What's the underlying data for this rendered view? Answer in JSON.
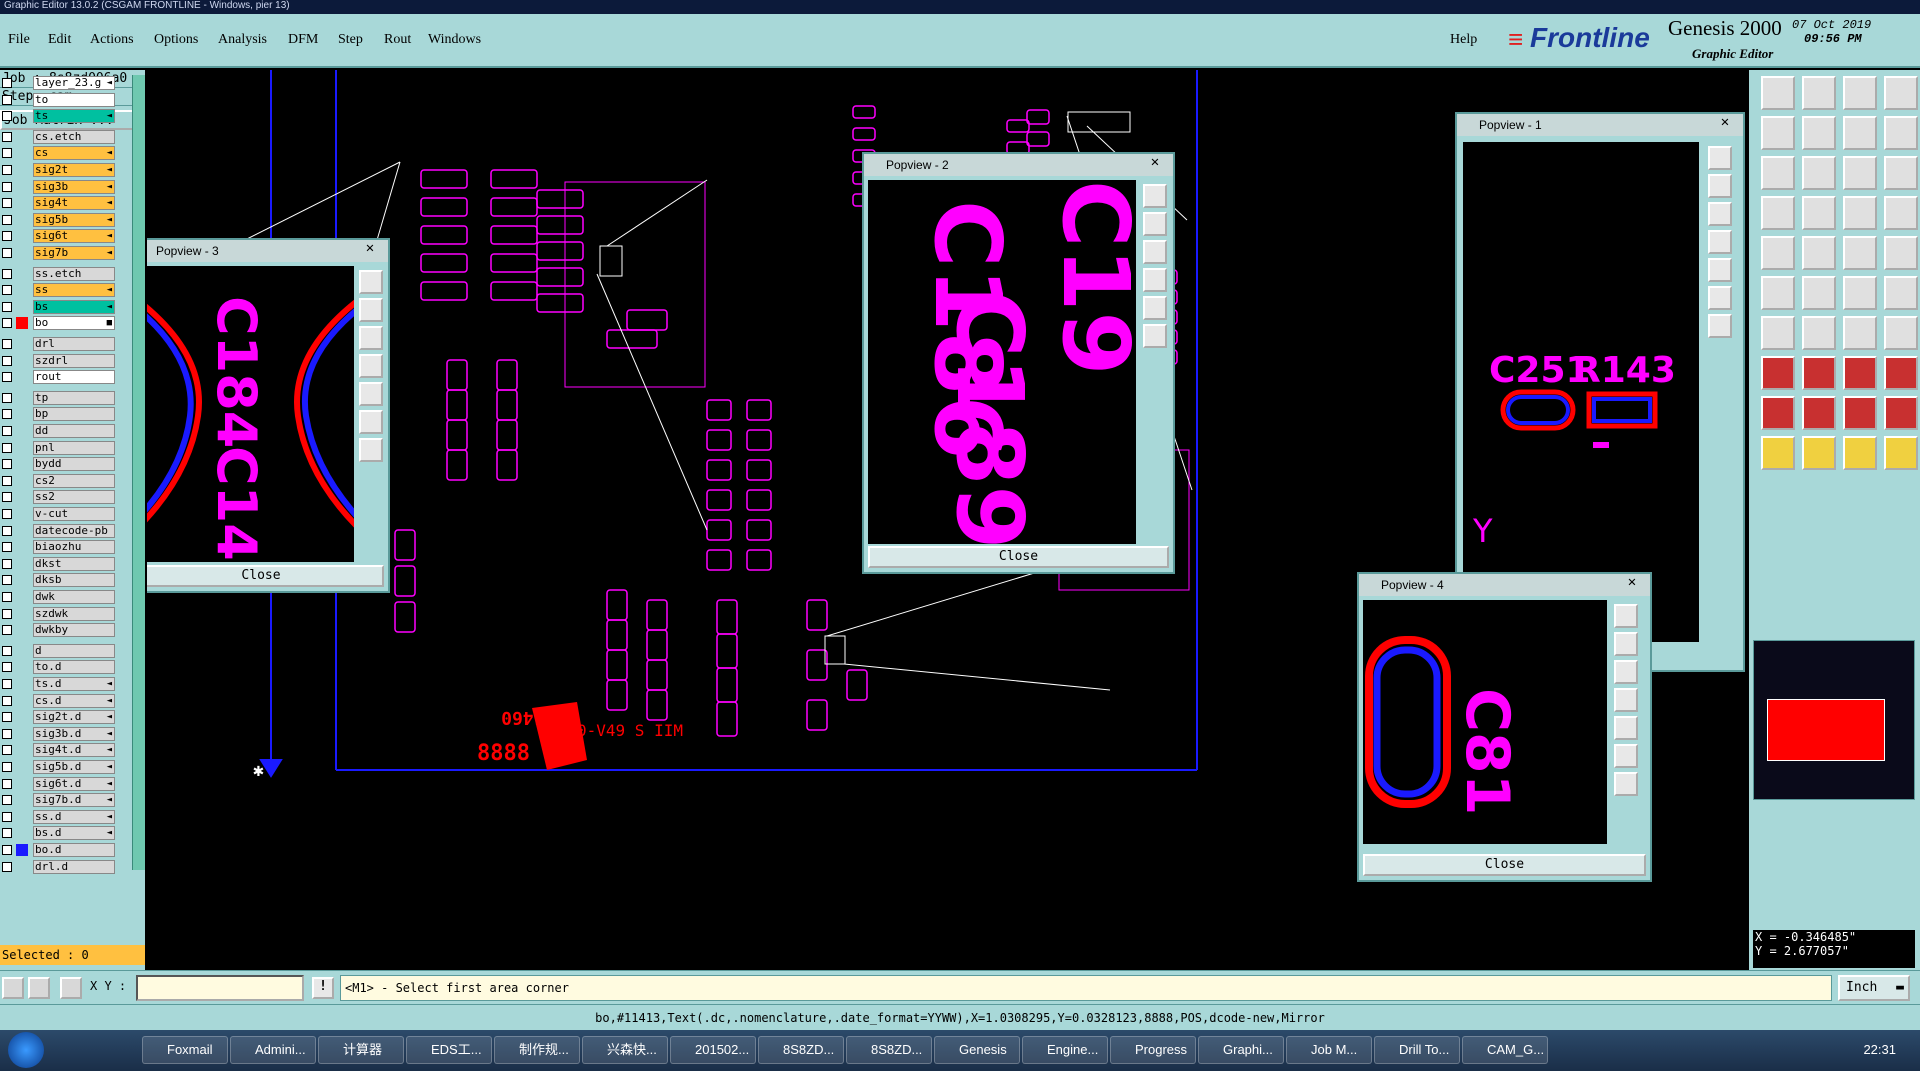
{
  "titlebar": {
    "title": "Graphic Editor 13.0.2 (CSGAM FRONTLINE - Windows, pier 13)"
  },
  "menu": {
    "items": [
      "File",
      "Edit",
      "Actions",
      "Options",
      "Analysis",
      "DFM",
      "Step",
      "Rout",
      "Windows"
    ],
    "help": "Help"
  },
  "brand": {
    "logo": "Frontline",
    "product": "Genesis 2000",
    "subtitle": "Graphic Editor",
    "date": "07 Oct 2019",
    "time": "09:56 PM"
  },
  "job": {
    "job": "Job : 8s8zd006a0",
    "step": "Step: cam",
    "matrix": "Job Matrix ..."
  },
  "layers": [
    {
      "name": "layer_23.g",
      "color": "#ffffff",
      "mark": "◄"
    },
    {
      "name": "to",
      "color": "#ffffff",
      "mark": ""
    },
    {
      "name": "ts",
      "color": "#00c0a0",
      "mark": "◄"
    },
    {
      "name": "cs.etch",
      "color": "#d8d8d8",
      "mark": ""
    },
    {
      "name": "cs",
      "color": "#ffc040",
      "mark": "◄"
    },
    {
      "name": "sig2t",
      "color": "#ffc040",
      "mark": "◄"
    },
    {
      "name": "sig3b",
      "color": "#ffc040",
      "mark": "◄"
    },
    {
      "name": "sig4t",
      "color": "#ffc040",
      "mark": "◄"
    },
    {
      "name": "sig5b",
      "color": "#ffc040",
      "mark": "◄"
    },
    {
      "name": "sig6t",
      "color": "#ffc040",
      "mark": "◄"
    },
    {
      "name": "sig7b",
      "color": "#ffc040",
      "mark": "◄"
    },
    {
      "name": "ss.etch",
      "color": "#d8d8d8",
      "mark": ""
    },
    {
      "name": "ss",
      "color": "#ffc040",
      "mark": "◄"
    },
    {
      "name": "bs",
      "color": "#00c0a0",
      "mark": "◄"
    },
    {
      "name": "bo",
      "color": "#ffffff",
      "mark": "■"
    },
    {
      "name": "drl",
      "color": "#d8d8d8",
      "mark": ""
    },
    {
      "name": "szdrl",
      "color": "#d8d8d8",
      "mark": ""
    },
    {
      "name": "rout",
      "color": "#ffffff",
      "mark": ""
    },
    {
      "name": "tp",
      "color": "#d8d8d8",
      "mark": ""
    },
    {
      "name": "bp",
      "color": "#d8d8d8",
      "mark": ""
    },
    {
      "name": "dd",
      "color": "#d8d8d8",
      "mark": ""
    },
    {
      "name": "pnl",
      "color": "#d8d8d8",
      "mark": ""
    },
    {
      "name": "bydd",
      "color": "#d8d8d8",
      "mark": ""
    },
    {
      "name": "cs2",
      "color": "#d8d8d8",
      "mark": ""
    },
    {
      "name": "ss2",
      "color": "#d8d8d8",
      "mark": ""
    },
    {
      "name": "v-cut",
      "color": "#d8d8d8",
      "mark": ""
    },
    {
      "name": "datecode-pb",
      "color": "#d8d8d8",
      "mark": ""
    },
    {
      "name": "biaozhu",
      "color": "#d8d8d8",
      "mark": ""
    },
    {
      "name": "dkst",
      "color": "#d8d8d8",
      "mark": ""
    },
    {
      "name": "dksb",
      "color": "#d8d8d8",
      "mark": ""
    },
    {
      "name": "dwk",
      "color": "#d8d8d8",
      "mark": ""
    },
    {
      "name": "szdwk",
      "color": "#d8d8d8",
      "mark": ""
    },
    {
      "name": "dwkby",
      "color": "#d8d8d8",
      "mark": ""
    },
    {
      "name": "d",
      "color": "#d8d8d8",
      "mark": ""
    },
    {
      "name": "to.d",
      "color": "#d8d8d8",
      "mark": ""
    },
    {
      "name": "ts.d",
      "color": "#d8d8d8",
      "mark": "◄"
    },
    {
      "name": "cs.d",
      "color": "#d8d8d8",
      "mark": "◄"
    },
    {
      "name": "sig2t.d",
      "color": "#d8d8d8",
      "mark": "◄"
    },
    {
      "name": "sig3b.d",
      "color": "#d8d8d8",
      "mark": "◄"
    },
    {
      "name": "sig4t.d",
      "color": "#d8d8d8",
      "mark": "◄"
    },
    {
      "name": "sig5b.d",
      "color": "#d8d8d8",
      "mark": "◄"
    },
    {
      "name": "sig6t.d",
      "color": "#d8d8d8",
      "mark": "◄"
    },
    {
      "name": "sig7b.d",
      "color": "#d8d8d8",
      "mark": "◄"
    },
    {
      "name": "ss.d",
      "color": "#d8d8d8",
      "mark": "◄"
    },
    {
      "name": "bs.d",
      "color": "#d8d8d8",
      "mark": "◄"
    },
    {
      "name": "bo.d",
      "color": "#d8d8d8",
      "mark": ""
    },
    {
      "name": "drl.d",
      "color": "#d8d8d8",
      "mark": ""
    }
  ],
  "selected": "Selected : 0",
  "cmd": {
    "xy_label": "X Y :",
    "prompt": "<M1> - Select first area corner",
    "units": "Inch"
  },
  "status": "bo,#11413,Text(.dc,.nomenclature,.date_format=YYWW),X=1.0308295,Y=0.0328123,8888,POS,dcode-new,Mirror",
  "coords": {
    "x": "X = -0.346485\"",
    "y": "Y = 2.677057\""
  },
  "popviews": [
    {
      "title": "Popview - 1",
      "close": "Close",
      "labels": [
        "C251",
        "R143"
      ]
    },
    {
      "title": "Popview - 2",
      "close": "Close",
      "labels": [
        "C186",
        "C189",
        "C19"
      ]
    },
    {
      "title": "Popview - 3",
      "close": "Close",
      "labels": [
        "C184",
        "C14"
      ]
    },
    {
      "title": "Popview - 4",
      "close": "Close",
      "labels": [
        "C81"
      ]
    }
  ],
  "pcb_text": {
    "line1": "E204460",
    "line2": "0-V49 S IIM",
    "line3": "8888"
  },
  "taskbar": {
    "items": [
      "Foxmail",
      "Admini...",
      "计算器",
      "EDS工...",
      "制作规...",
      "兴森快...",
      "201502...",
      "8S8ZD...",
      "8S8ZD...",
      "Genesis",
      "Engine...",
      "Progress",
      "Graphi...",
      "Job M...",
      "Drill To...",
      "CAM_G..."
    ],
    "clock": "22:31"
  },
  "colors": {
    "ui": "#a8d8d8",
    "magenta": "#ff00ff",
    "red": "#ff0000",
    "blue": "#1a1aff"
  }
}
